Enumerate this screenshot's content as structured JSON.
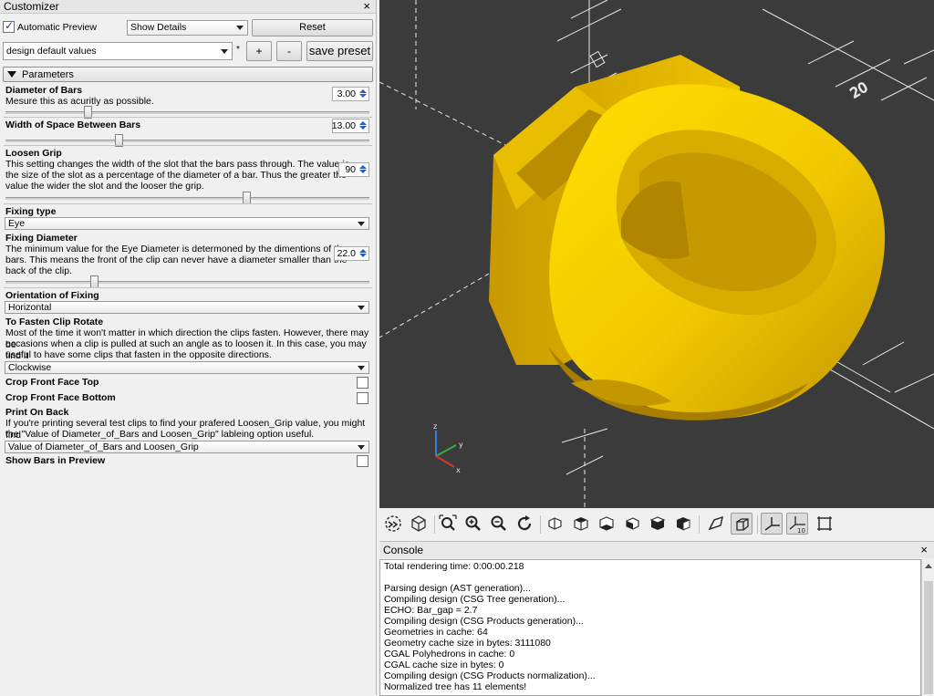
{
  "customizer": {
    "title": "Customizer",
    "close": "×",
    "auto_preview_label": "Automatic Preview",
    "auto_preview_checked": true,
    "details_select": "Show Details",
    "reset_label": "Reset",
    "preset_select": "design default values",
    "preset_marker": "*",
    "plus_label": "+",
    "minus_label": "-",
    "save_preset_label": "save preset",
    "parameters_header": "Parameters",
    "params": {
      "diameter": {
        "label": "Diameter of Bars",
        "desc": "Mesure this as acuritly as possible.",
        "value": "3.00",
        "slider": 0.22
      },
      "width_space": {
        "label": "Width of Space Between Bars",
        "value": "13.00",
        "slider": 0.31
      },
      "loosen": {
        "label": "Loosen Grip",
        "desc1": "This setting changes the width of the slot that the bars pass through. The value is",
        "desc2": "the size of the slot as a percentage of the diameter of a bar. Thus the greater the",
        "desc3": "value the wider the slot and the looser the grip.",
        "value": "90",
        "slider": 0.66
      },
      "fixing_type": {
        "label": "Fixing type",
        "value": "Eye"
      },
      "fixing_diameter": {
        "label": "Fixing Diameter",
        "desc1": "The minimum value for the Eye Diameter is determoned by the dimentions of the",
        "desc2": "bars. This means the front of the clip can never have a  diameter smaller than the",
        "desc3": "back of the clip.",
        "value": "22.0",
        "slider": 0.24
      },
      "orientation": {
        "label": "Orientation of Fixing",
        "value": "Horizontal"
      },
      "rotate": {
        "label": "To Fasten Clip Rotate",
        "desc1": "Most of the time it won't matter in which direction the clips fasten. However, there may be",
        "desc2": "occasions when a clip is pulled at such an angle as to loosen it. In this case, you may find it",
        "desc3": "useful to have some clips that fasten in the opposite directions.",
        "value": "Clockwise"
      },
      "crop_top": {
        "label": "Crop Front Face Top",
        "checked": false
      },
      "crop_bottom": {
        "label": "Crop Front Face Bottom",
        "checked": false
      },
      "print_back": {
        "label": "Print On Back",
        "desc1": "If you're printing several test clips to find your prafered Loosen_Grip value, you might find",
        "desc2": "the \"Value of Diameter_of_Bars and Loosen_Grip\" lableing option useful.",
        "value": "Value of Diameter_of_Bars and Loosen_Grip"
      },
      "show_bars": {
        "label": "Show Bars in Preview",
        "checked": false
      }
    }
  },
  "viewport": {
    "model_color": "#f2d000",
    "background": "#3b3b3b",
    "axis_labels": [
      "z",
      "y",
      "x"
    ],
    "ruler_label": "20"
  },
  "toolbar": {
    "buttons": [
      "render-icon",
      "view-all-icon",
      "zoom-fit-icon",
      "zoom-in-icon",
      "zoom-out-icon",
      "reset-view-icon",
      "view-right-icon",
      "view-top-icon",
      "view-bottom-icon",
      "view-left-icon",
      "view-front-icon",
      "view-back-icon",
      "perspective-icon",
      "orthogonal-icon",
      "show-axes-icon",
      "show-scale-markers-icon",
      "show-edges-icon"
    ],
    "scale_marker_num": "10"
  },
  "console": {
    "title": "Console",
    "close": "×",
    "lines": [
      "Total rendering time: 0:00:00.218",
      "",
      "Parsing design (AST generation)...",
      "Compiling design (CSG Tree generation)...",
      "ECHO: Bar_gap = 2.7",
      "Compiling design (CSG Products generation)...",
      "Geometries in cache: 64",
      "Geometry cache size in bytes: 3111080",
      "CGAL Polyhedrons in cache: 0",
      "CGAL cache size in bytes: 0",
      "Compiling design (CSG Products normalization)...",
      "Normalized tree has 11 elements!"
    ]
  }
}
